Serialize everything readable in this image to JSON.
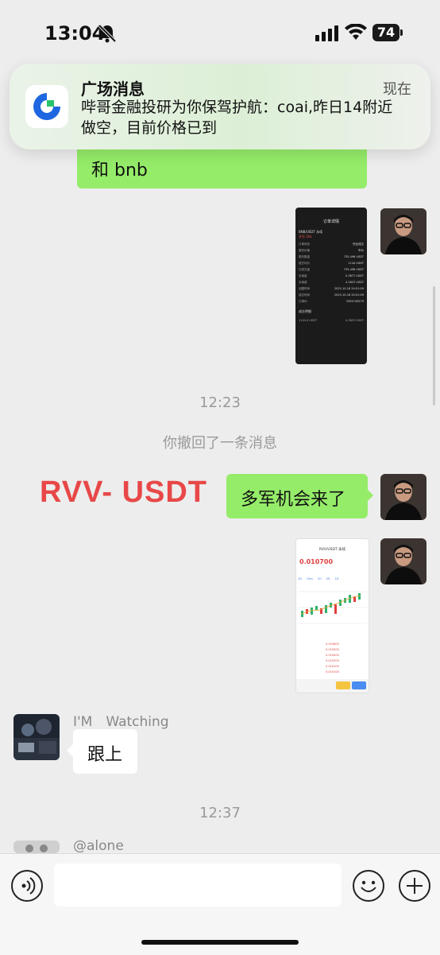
{
  "status_bar": {
    "time": "13:04",
    "battery": "74"
  },
  "notification": {
    "title": "广场消息",
    "time": "现在",
    "body": "哔哥金融投研为你保驾护航：coai,昨日14附近做空，目前价格已到"
  },
  "messages": {
    "partial_bubble_text": "和 bnb",
    "timestamp_1": "12:23",
    "recall_notice": "你撤回了一条消息",
    "overlay_text": "RVV- USDT",
    "bubble_duojun": "多军机会来了",
    "sender_watching_name": "I'M　Watching",
    "bubble_genshang": "跟上",
    "timestamp_2": "12:37",
    "sender_alone_name": "@alone"
  },
  "screenshot_1": {
    "title": "订单详情",
    "pair": "BNB/USDT 永续",
    "tags": [
      "开空",
      "20x"
    ],
    "rows": [
      {
        "k": "订单状态",
        "v": "完全成交"
      },
      {
        "k": "委托价格",
        "v": "市价"
      },
      {
        "k": "委托数量",
        "v": "735.496 USDT"
      },
      {
        "k": "成交均价",
        "v": "1144 USDT"
      },
      {
        "k": "已成交量",
        "v": "735.496 USDT"
      },
      {
        "k": "手续费",
        "v": "0.3677 USDT"
      },
      {
        "k": "手续费",
        "v": "4.2623 USDT"
      },
      {
        "k": "创建时间",
        "v": "2025-10-18 20:01:09"
      },
      {
        "k": "成交时间",
        "v": "2025-10-18 20:01:09"
      },
      {
        "k": "订单ID",
        "v": "3305740579"
      }
    ],
    "section": "成交明细",
    "footer": [
      {
        "k": "1144.4 USDT",
        "v": "4.3623 USDT"
      }
    ]
  },
  "screenshot_2": {
    "pair": "RVV/USDT 永续",
    "price": "0.010700",
    "tabs": [
      "1D",
      "15m",
      "1H",
      "4H",
      "1D"
    ],
    "list_values": [
      "0.010600",
      "0.010500",
      "0.010400",
      "0.010300",
      "0.010200",
      "0.010100"
    ]
  }
}
